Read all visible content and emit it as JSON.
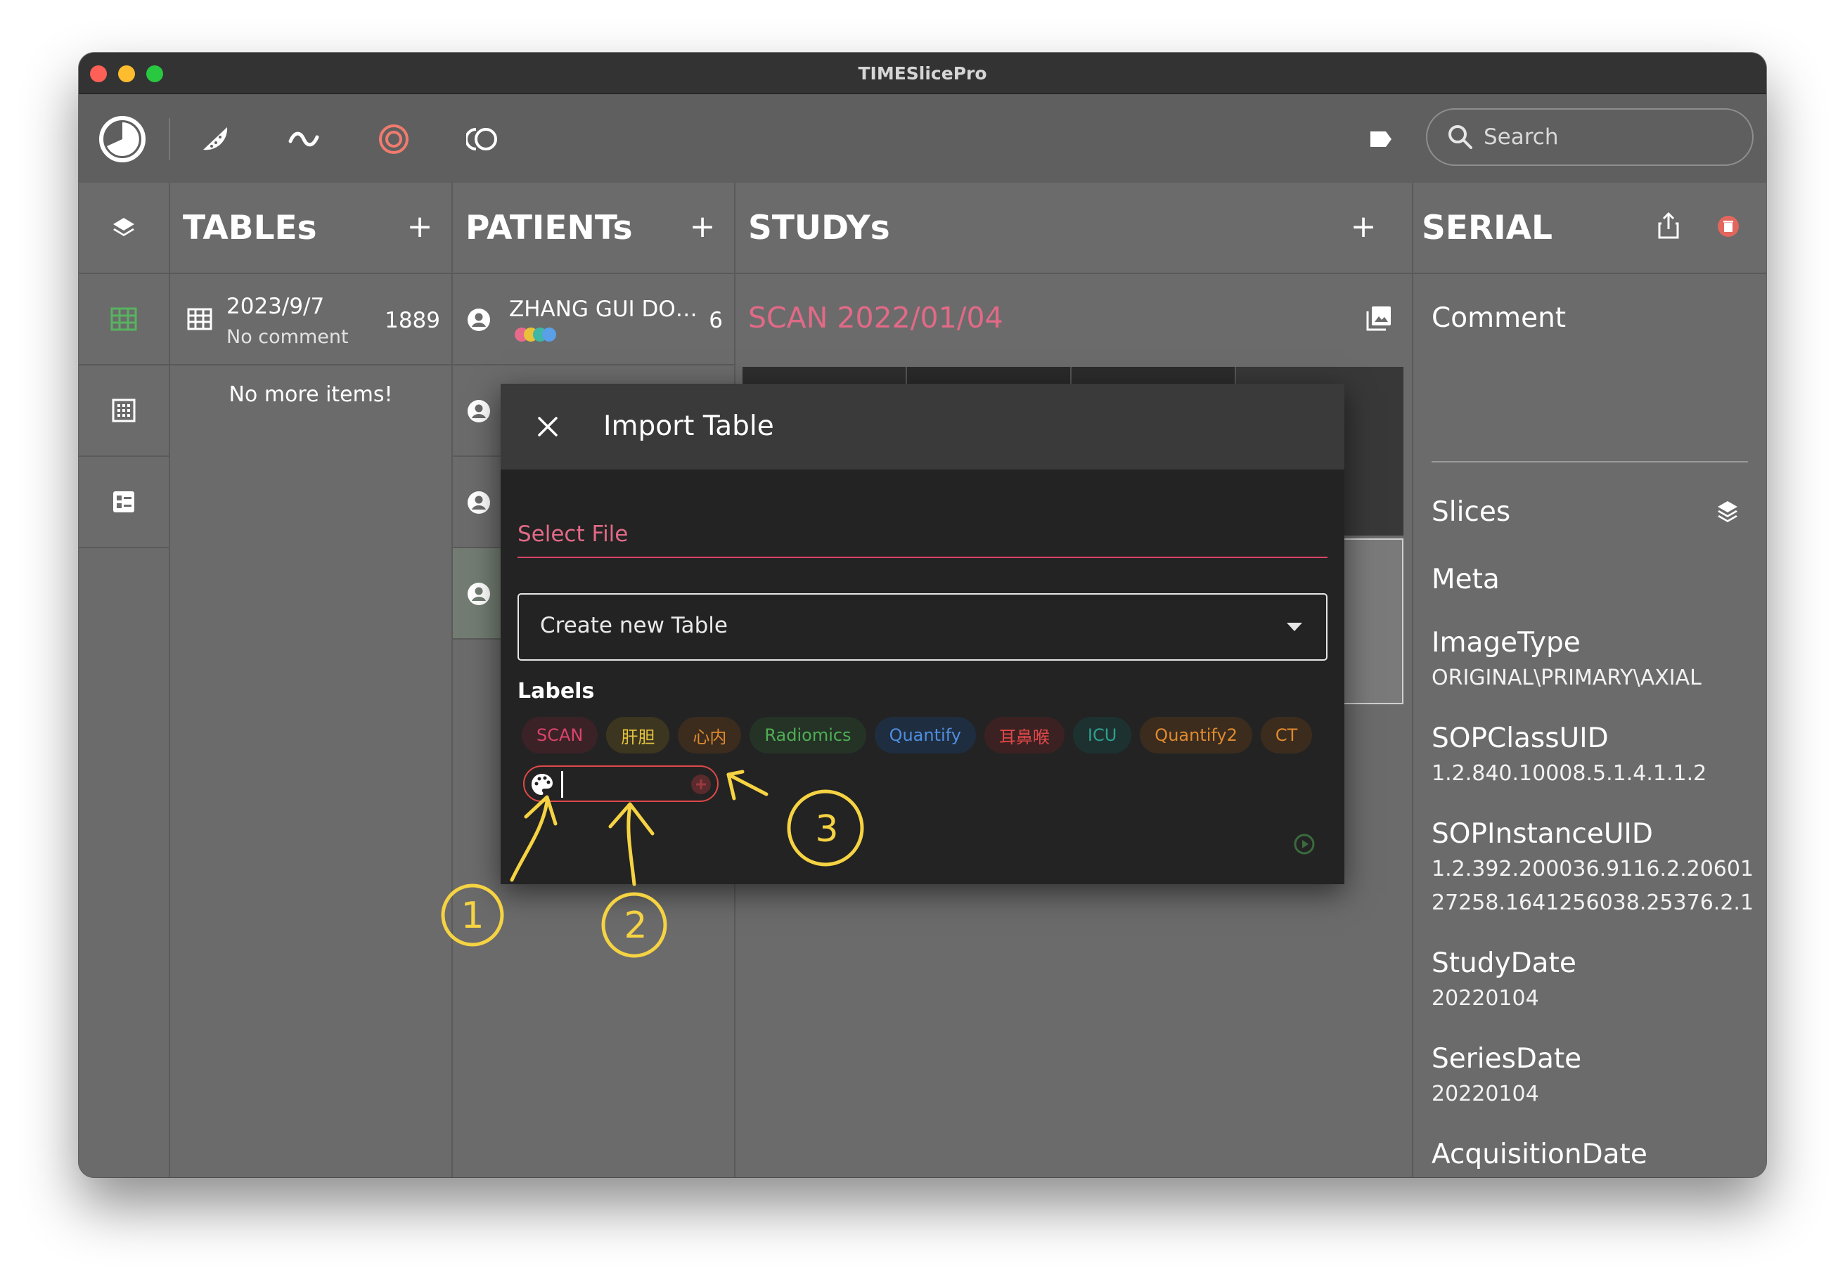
{
  "window": {
    "title": "TIMESlicePro",
    "traffic_lights": [
      "#fe5f57",
      "#febc2e",
      "#28c840"
    ]
  },
  "toolbar": {
    "icons": [
      "time-slice-logo-icon",
      "watermelon-icon",
      "wave-icon",
      "target-icon",
      "rings-icon",
      "tag-icon"
    ],
    "search_placeholder": "Search"
  },
  "sidebar": {
    "icons": [
      "layers-icon",
      "table-grid-icon",
      "dot-grid-icon",
      "form-list-icon"
    ]
  },
  "tables": {
    "title": "TABLEs",
    "add": "+",
    "items": [
      {
        "date": "2023/9/7",
        "comment": "No comment",
        "count": "1889"
      }
    ],
    "empty": "No more items!"
  },
  "patients": {
    "title": "PATIENTs",
    "add": "+",
    "items": [
      {
        "name": "ZHANG GUI DO…",
        "count": "6"
      }
    ],
    "dot_colors": [
      "#e86a8a",
      "#e8c03a",
      "#3fb6a6",
      "#5aa0e8"
    ]
  },
  "studys": {
    "title": "STUDYs",
    "add": "+",
    "item_title": "SCAN 2022/01/04"
  },
  "serial": {
    "title": "SERIAL",
    "comment_label": "Comment",
    "slices_label": "Slices",
    "meta_label": "Meta",
    "meta": [
      {
        "key": "ImageType",
        "value": "ORIGINAL\\PRIMARY\\AXIAL"
      },
      {
        "key": "SOPClassUID",
        "value": "1.2.840.10008.5.1.4.1.1.2"
      },
      {
        "key": "SOPInstanceUID",
        "value": "1.2.392.200036.9116.2.2060127258.1641256038.25376.2.1"
      },
      {
        "key": "StudyDate",
        "value": "20220104"
      },
      {
        "key": "SeriesDate",
        "value": "20220104"
      },
      {
        "key": "AcquisitionDate",
        "value": ""
      }
    ]
  },
  "dialog": {
    "title": "Import Table",
    "select_file_label": "Select File",
    "table_select_value": "Create new Table",
    "labels_heading": "Labels",
    "labels": [
      {
        "text": "SCAN",
        "color": "#d9436a",
        "bg": "#3b2226"
      },
      {
        "text": "肝胆",
        "color": "#e6c340",
        "bg": "#3c3620"
      },
      {
        "text": "心内",
        "color": "#e0892e",
        "bg": "#3b2c1e"
      },
      {
        "text": "Radiomics",
        "color": "#4fae55",
        "bg": "#243326"
      },
      {
        "text": "Quantify",
        "color": "#4d8fe0",
        "bg": "#1f2d40"
      },
      {
        "text": "耳鼻喉",
        "color": "#e0484a",
        "bg": "#3b2121"
      },
      {
        "text": "ICU",
        "color": "#2f9e8e",
        "bg": "#1d3230"
      },
      {
        "text": "Quantify2",
        "color": "#e08a2e",
        "bg": "#3b2c1e"
      },
      {
        "text": "CT",
        "color": "#e08a2e",
        "bg": "#3b2c1e"
      }
    ],
    "new_label_value": ""
  },
  "annotations": [
    "1",
    "2",
    "3"
  ]
}
